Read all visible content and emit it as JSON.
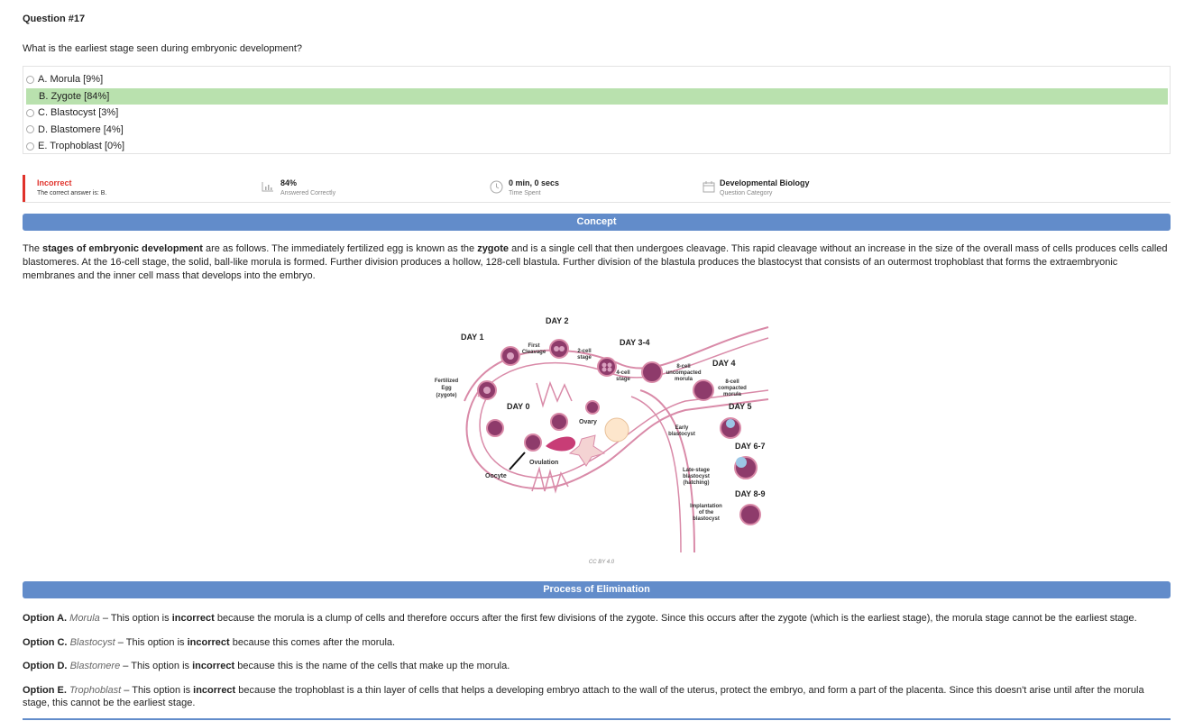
{
  "question": {
    "number": "Question #17",
    "text": "What is the earliest stage seen during embryonic development?"
  },
  "options": [
    {
      "label": "A. Morula [9%]",
      "correct": false
    },
    {
      "label": "B. Zygote [84%]",
      "correct": true
    },
    {
      "label": "C. Blastocyst [3%]",
      "correct": false
    },
    {
      "label": "D. Blastomere [4%]",
      "correct": false
    },
    {
      "label": "E. Trophoblast [0%]",
      "correct": false
    }
  ],
  "stats": {
    "result": "Incorrect",
    "correct_answer": "The correct answer is: B.",
    "percent": "84%",
    "percent_label": "Answered Correctly",
    "time": "0 min, 0 secs",
    "time_label": "Time Spent",
    "category": "Developmental Biology",
    "category_label": "Question Category"
  },
  "concept": {
    "heading": "Concept",
    "p1": "The ",
    "b1": "stages of embryonic development",
    "p2": " are as follows. The immediately fertilized egg is known as the ",
    "b2": "zygote",
    "p3": " and is a single cell that then undergoes cleavage. This rapid cleavage without an increase in the size of the overall mass of cells produces cells called blastomeres. At the 16-cell stage, the solid, ball-like morula is formed. Further division produces a hollow, 128-cell blastula. Further division of the blastula produces the blastocyst that consists of an outermost trophoblast that forms the extraembryonic membranes and the inner cell mass that develops into the embryo."
  },
  "figure": {
    "labels": {
      "day0": "DAY 0",
      "day1": "DAY 1",
      "day2": "DAY 2",
      "day34": "DAY 3-4",
      "day4": "DAY 4",
      "day5": "DAY 5",
      "day67": "DAY 6-7",
      "day89": "DAY 8-9",
      "fertilized": "Fertilized",
      "egg": "Egg",
      "zygote": "(zygote)",
      "first": "First",
      "cleavage": "Cleavage",
      "twocell1": "2-cell",
      "twocell2": "stage",
      "fourcell1": "4-cell",
      "fourcell2": "stage",
      "eight1": "8-cell",
      "eight2": "uncompacted",
      "eight3": "morula",
      "eightc1": "8-cell",
      "eightc2": "compacted",
      "eightc3": "morula",
      "early1": "Early",
      "early2": "blastocyst",
      "late1": "Late-stage",
      "late2": "blastocyst",
      "late3": "(hatching)",
      "impl1": "Implantation",
      "impl2": "of the",
      "impl3": "blastocyst",
      "ovary": "Ovary",
      "ovulation": "Ovulation",
      "oocyte": "Oocyte"
    },
    "credit": "CC BY 4.0"
  },
  "elimination": {
    "heading": "Process of Elimination",
    "a": {
      "opt": "Option A.",
      "name": "Morula",
      "t1": " – This option is ",
      "bold": "incorrect",
      "t2": " because the morula is a clump of cells and therefore occurs after the first few divisions of the zygote. Since this occurs after the zygote (which is the earliest stage), the morula stage cannot be the earliest stage."
    },
    "c": {
      "opt": "Option C.",
      "name": "Blastocyst",
      "t1": " – This option is ",
      "bold": "incorrect",
      "t2": " because this comes after the morula."
    },
    "d": {
      "opt": "Option D.",
      "name": "Blastomere",
      "t1": " – This option is ",
      "bold": "incorrect",
      "t2": " because this is the name of the cells that make up the morula."
    },
    "e": {
      "opt": "Option E.",
      "name": "Trophoblast",
      "t1": " – This option is ",
      "bold": "incorrect",
      "t2": " because the trophoblast is a thin layer of cells that helps a developing embryo attach to the wall of the uterus, protect the embryo, and form a part of the placenta. Since this doesn't arise until after the morula stage, this cannot be the earliest stage."
    }
  },
  "colors": {
    "accent": "#628cca",
    "correct": "#b9e1ae",
    "incorrect": "#e0322b"
  }
}
